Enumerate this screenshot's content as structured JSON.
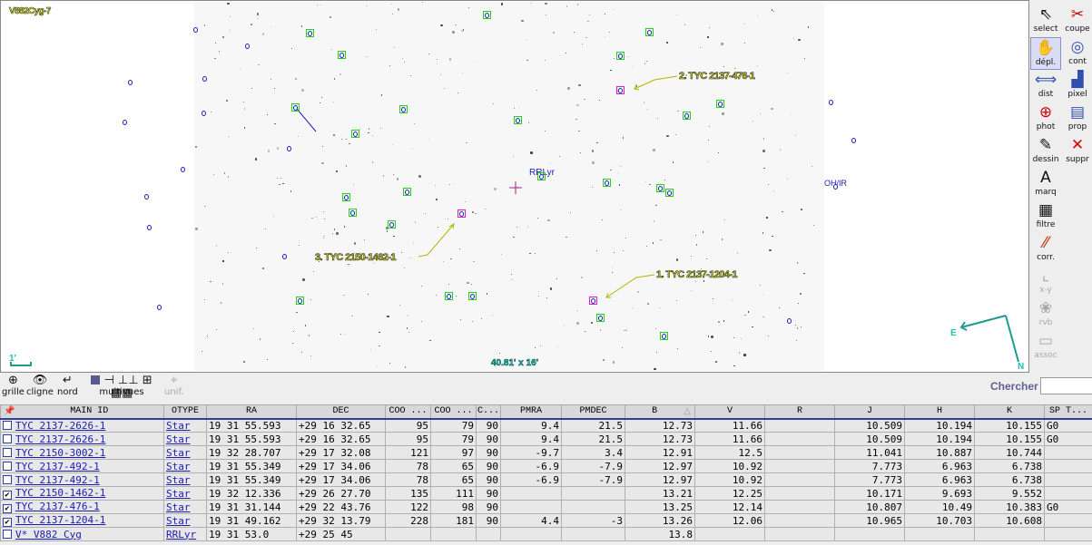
{
  "view": {
    "title": "V882Cyg-7",
    "field_size": "40.81' x 16'",
    "scale_label": "1'",
    "center_label": "RRLyr",
    "other_label": "OH/IR",
    "compass": {
      "east": "E",
      "north": "N"
    },
    "annotations": [
      "1. TYC 2137-1204-1",
      "2. TYC 2137-476-1",
      "3. TYC 2150-1462-1"
    ]
  },
  "colors": {
    "marker": "#1ed21e",
    "selected": "#e01ec8",
    "source": "#1a1ab4",
    "annotation": "#c8d200"
  },
  "tools": [
    {
      "label": "select",
      "icon": "arrow-cursor",
      "enabled": true
    },
    {
      "label": "coupe",
      "icon": "scissors",
      "enabled": true
    },
    {
      "label": "dépl.",
      "icon": "hand",
      "enabled": true,
      "active": true
    },
    {
      "label": "cont",
      "icon": "contour",
      "enabled": true
    },
    {
      "label": "dist",
      "icon": "distance",
      "enabled": true
    },
    {
      "label": "pixel",
      "icon": "histogram",
      "enabled": true
    },
    {
      "label": "phot",
      "icon": "photometry",
      "enabled": true
    },
    {
      "label": "prop",
      "icon": "properties",
      "enabled": true
    },
    {
      "label": "dessin",
      "icon": "pencil",
      "enabled": true
    },
    {
      "label": "suppr",
      "icon": "delete",
      "enabled": true
    },
    {
      "label": "marq",
      "icon": "tag",
      "enabled": true
    },
    {
      "label": "filtre",
      "icon": "filter",
      "enabled": true
    },
    {
      "label": "corr.",
      "icon": "matches",
      "enabled": true
    },
    {
      "label": "x-y",
      "icon": "xy-plot",
      "enabled": false
    },
    {
      "label": "rvb",
      "icon": "rgb",
      "enabled": false
    },
    {
      "label": "assoc",
      "icon": "film",
      "enabled": false
    }
  ],
  "bottom_tools": [
    {
      "label": "grille",
      "icon": "grid-globe"
    },
    {
      "label": "cligne",
      "icon": "eye"
    },
    {
      "label": "nord",
      "icon": "north"
    },
    {
      "label": "multivues",
      "icon": "multiview"
    },
    {
      "label": "unif.",
      "icon": "crosshair",
      "enabled": false
    }
  ],
  "search": {
    "label": "Chercher",
    "value": ""
  },
  "table": {
    "headers": [
      "MAIN ID",
      "OTYPE",
      "RA",
      "DEC",
      "COO ...",
      "COO ...",
      "C...",
      "PMRA",
      "PMDEC",
      "B",
      "V",
      "R",
      "J",
      "H",
      "K",
      "SP T..."
    ],
    "sort_column": "B",
    "sort_dir": "asc",
    "rows": [
      {
        "checked": false,
        "cells": [
          "TYC 2137-2626-1",
          "Star",
          "19 31 55.593",
          "+29 16 32.65",
          "95",
          "79",
          "90",
          "9.4",
          "21.5",
          "12.73",
          "11.66",
          "",
          "10.509",
          "10.194",
          "10.155",
          "G0"
        ]
      },
      {
        "checked": false,
        "cells": [
          "TYC 2137-2626-1",
          "Star",
          "19 31 55.593",
          "+29 16 32.65",
          "95",
          "79",
          "90",
          "9.4",
          "21.5",
          "12.73",
          "11.66",
          "",
          "10.509",
          "10.194",
          "10.155",
          "G0"
        ]
      },
      {
        "checked": false,
        "cells": [
          "TYC 2150-3002-1",
          "Star",
          "19 32 28.707",
          "+29 17 32.08",
          "121",
          "97",
          "90",
          "-9.7",
          "3.4",
          "12.91",
          "12.5",
          "",
          "11.041",
          "10.887",
          "10.744",
          ""
        ]
      },
      {
        "checked": false,
        "cells": [
          "TYC 2137-492-1",
          "Star",
          "19 31 55.349",
          "+29 17 34.06",
          "78",
          "65",
          "90",
          "-6.9",
          "-7.9",
          "12.97",
          "10.92",
          "",
          "7.773",
          "6.963",
          "6.738",
          ""
        ]
      },
      {
        "checked": false,
        "cells": [
          "TYC 2137-492-1",
          "Star",
          "19 31 55.349",
          "+29 17 34.06",
          "78",
          "65",
          "90",
          "-6.9",
          "-7.9",
          "12.97",
          "10.92",
          "",
          "7.773",
          "6.963",
          "6.738",
          ""
        ]
      },
      {
        "checked": true,
        "cells": [
          "TYC 2150-1462-1",
          "Star",
          "19 32 12.336",
          "+29 26 27.70",
          "135",
          "111",
          "90",
          "",
          "",
          "13.21",
          "12.25",
          "",
          "10.171",
          "9.693",
          "9.552",
          ""
        ]
      },
      {
        "checked": true,
        "cells": [
          "TYC 2137-476-1",
          "Star",
          "19 31 31.144",
          "+29 22 43.76",
          "122",
          "98",
          "90",
          "",
          "",
          "13.25",
          "12.14",
          "",
          "10.807",
          "10.49",
          "10.383",
          "G0"
        ]
      },
      {
        "checked": true,
        "cells": [
          "TYC 2137-1204-1",
          "Star",
          "19 31 49.162",
          "+29 32 13.79",
          "228",
          "181",
          "90",
          "4.4",
          "-3",
          "13.26",
          "12.06",
          "",
          "10.965",
          "10.703",
          "10.608",
          ""
        ]
      },
      {
        "checked": false,
        "cells": [
          "V* V882 Cyg",
          "RRLyr",
          "19 31 53.0",
          "+29 25 45",
          "",
          "",
          "",
          "",
          "",
          "13.8",
          "",
          "",
          "",
          "",
          "",
          ""
        ]
      }
    ]
  }
}
